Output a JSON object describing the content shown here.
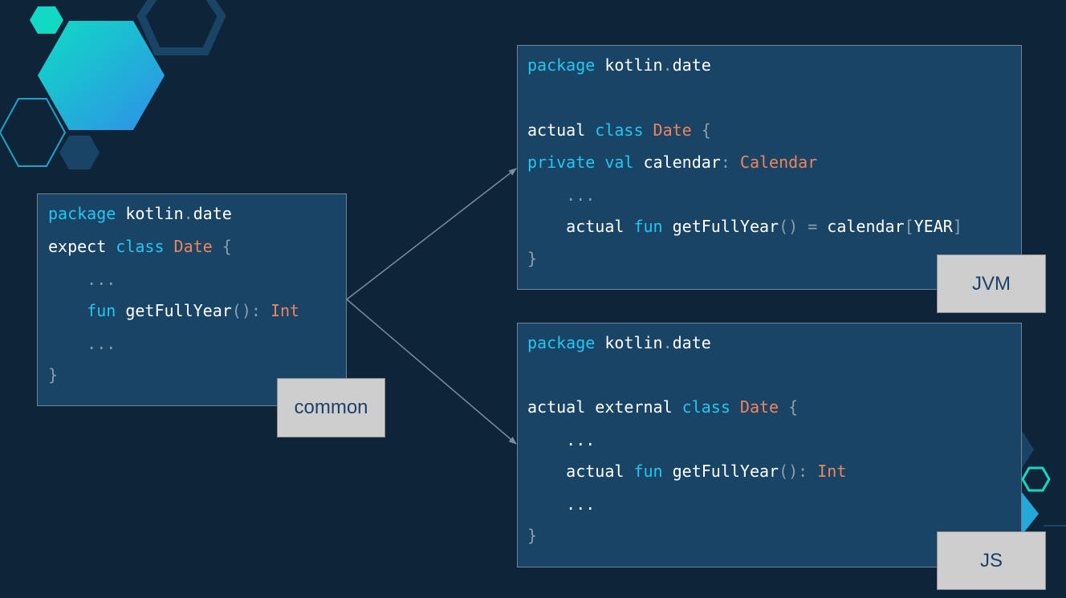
{
  "colors": {
    "background": "#0e2539",
    "box": "#1a4466",
    "keyword": "#22c7f2",
    "type": "#f0845a",
    "punct": "#8a9fb0",
    "label_bg": "#cecece",
    "label_text": "#1c4168"
  },
  "common": {
    "label": "common",
    "lines": [
      [
        {
          "t": "package",
          "c": "kw"
        },
        {
          "t": " kotlin",
          "c": "id"
        },
        {
          "t": ".",
          "c": "pn"
        },
        {
          "t": "date",
          "c": "id"
        }
      ],
      [
        {
          "t": "expect ",
          "c": "id"
        },
        {
          "t": "class ",
          "c": "kw"
        },
        {
          "t": "Date ",
          "c": "ty"
        },
        {
          "t": "{",
          "c": "pn"
        }
      ],
      [
        {
          "t": "    ...",
          "c": "pn"
        }
      ],
      [
        {
          "t": "    ",
          "c": "id"
        },
        {
          "t": "fun ",
          "c": "kw"
        },
        {
          "t": "getFullYear",
          "c": "id"
        },
        {
          "t": "(): ",
          "c": "pn"
        },
        {
          "t": "Int",
          "c": "ty"
        }
      ],
      [
        {
          "t": "    ...",
          "c": "pn"
        }
      ],
      [
        {
          "t": "}",
          "c": "pn"
        }
      ]
    ]
  },
  "jvm": {
    "label": "JVM",
    "lines": [
      [
        {
          "t": "package",
          "c": "kw"
        },
        {
          "t": " kotlin",
          "c": "id"
        },
        {
          "t": ".",
          "c": "pn"
        },
        {
          "t": "date",
          "c": "id"
        }
      ],
      [],
      [
        {
          "t": "actual ",
          "c": "id"
        },
        {
          "t": "class ",
          "c": "kw"
        },
        {
          "t": "Date ",
          "c": "ty"
        },
        {
          "t": "{",
          "c": "pn"
        }
      ],
      [
        {
          "t": "private val ",
          "c": "kw"
        },
        {
          "t": "calendar",
          "c": "id"
        },
        {
          "t": ": ",
          "c": "pn"
        },
        {
          "t": "Calendar",
          "c": "ty"
        }
      ],
      [
        {
          "t": "    ...",
          "c": "pn"
        }
      ],
      [
        {
          "t": "    actual ",
          "c": "id"
        },
        {
          "t": "fun ",
          "c": "kw"
        },
        {
          "t": "getFullYear",
          "c": "id"
        },
        {
          "t": "() = ",
          "c": "pn"
        },
        {
          "t": "calendar",
          "c": "id"
        },
        {
          "t": "[",
          "c": "pn"
        },
        {
          "t": "YEAR",
          "c": "id"
        },
        {
          "t": "]",
          "c": "pn"
        }
      ],
      [
        {
          "t": "}",
          "c": "pn"
        }
      ]
    ]
  },
  "js": {
    "label": "JS",
    "lines": [
      [
        {
          "t": "package",
          "c": "kw"
        },
        {
          "t": " kotlin",
          "c": "id"
        },
        {
          "t": ".",
          "c": "pn"
        },
        {
          "t": "date",
          "c": "id"
        }
      ],
      [],
      [
        {
          "t": "actual external ",
          "c": "id"
        },
        {
          "t": "class ",
          "c": "kw"
        },
        {
          "t": "Date ",
          "c": "ty"
        },
        {
          "t": "{",
          "c": "pn"
        }
      ],
      [
        {
          "t": "    ...",
          "c": "id"
        }
      ],
      [
        {
          "t": "    actual ",
          "c": "id"
        },
        {
          "t": "fun ",
          "c": "kw"
        },
        {
          "t": "getFullYear",
          "c": "id"
        },
        {
          "t": "(): ",
          "c": "pn"
        },
        {
          "t": "Int",
          "c": "ty"
        }
      ],
      [
        {
          "t": "    ...",
          "c": "id"
        }
      ],
      [
        {
          "t": "}",
          "c": "pn"
        }
      ]
    ]
  }
}
